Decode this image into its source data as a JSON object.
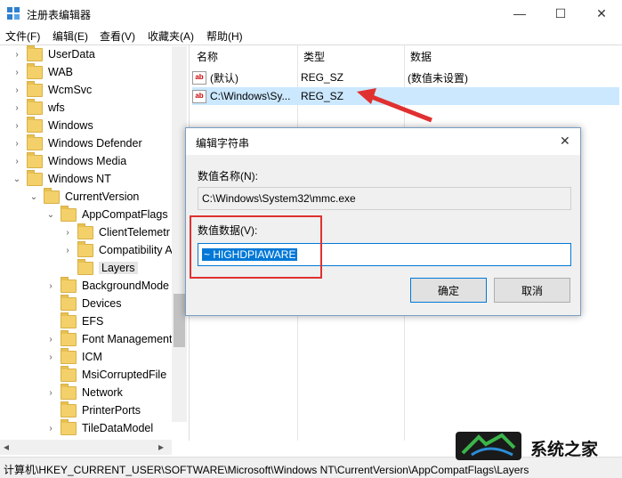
{
  "window": {
    "title": "注册表编辑器",
    "minimize_glyph": "—",
    "maximize_glyph": "☐",
    "close_glyph": "✕"
  },
  "menu": [
    "文件(F)",
    "编辑(E)",
    "查看(V)",
    "收藏夹(A)",
    "帮助(H)"
  ],
  "tree": {
    "items": [
      {
        "label": "UserData",
        "level": 0,
        "chevron": "›"
      },
      {
        "label": "WAB",
        "level": 0,
        "chevron": "›"
      },
      {
        "label": "WcmSvc",
        "level": 0,
        "chevron": "›"
      },
      {
        "label": "wfs",
        "level": 0,
        "chevron": "›"
      },
      {
        "label": "Windows",
        "level": 0,
        "chevron": "›"
      },
      {
        "label": "Windows Defender",
        "level": 0,
        "chevron": "›"
      },
      {
        "label": "Windows Media",
        "level": 0,
        "chevron": "›"
      },
      {
        "label": "Windows NT",
        "level": 0,
        "chevron": "⌄"
      },
      {
        "label": "CurrentVersion",
        "level": 1,
        "chevron": "⌄"
      },
      {
        "label": "AppCompatFlags",
        "level": 2,
        "chevron": "⌄"
      },
      {
        "label": "ClientTelemetr",
        "level": 3,
        "chevron": "›"
      },
      {
        "label": "Compatibility A",
        "level": 3,
        "chevron": "›"
      },
      {
        "label": "Layers",
        "level": 3,
        "chevron": "",
        "selected": true
      },
      {
        "label": "BackgroundMode",
        "level": 2,
        "chevron": "›"
      },
      {
        "label": "Devices",
        "level": 2,
        "chevron": ""
      },
      {
        "label": "EFS",
        "level": 2,
        "chevron": ""
      },
      {
        "label": "Font Management",
        "level": 2,
        "chevron": "›"
      },
      {
        "label": "ICM",
        "level": 2,
        "chevron": "›"
      },
      {
        "label": "MsiCorruptedFile",
        "level": 2,
        "chevron": ""
      },
      {
        "label": "Network",
        "level": 2,
        "chevron": "›"
      },
      {
        "label": "PrinterPorts",
        "level": 2,
        "chevron": ""
      },
      {
        "label": "TileDataModel",
        "level": 2,
        "chevron": "›"
      }
    ],
    "scroll_left": "◂",
    "scroll_right": "▸"
  },
  "list": {
    "columns": [
      "名称",
      "类型",
      "数据"
    ],
    "rows": [
      {
        "name": "(默认)",
        "type": "REG_SZ",
        "data": "(数值未设置)"
      },
      {
        "name": "C:\\Windows\\Sy...",
        "type": "REG_SZ",
        "data": ""
      }
    ],
    "value_icon_text": "ab"
  },
  "status": "计算机\\HKEY_CURRENT_USER\\SOFTWARE\\Microsoft\\Windows NT\\CurrentVersion\\AppCompatFlags\\Layers",
  "dialog": {
    "title": "编辑字符串",
    "close_glyph": "✕",
    "name_label": "数值名称(N):",
    "name_value": "C:\\Windows\\System32\\mmc.exe",
    "data_label": "数值数据(V):",
    "data_value": "~ HIGHDPIAWARE",
    "ok": "确定",
    "cancel": "取消"
  },
  "watermark": {
    "text": "系统之家"
  },
  "colors": {
    "highlight_red": "#e03030",
    "selection_blue": "#0078d7",
    "row_select": "#cce8ff",
    "folder": "#f3d06a"
  }
}
